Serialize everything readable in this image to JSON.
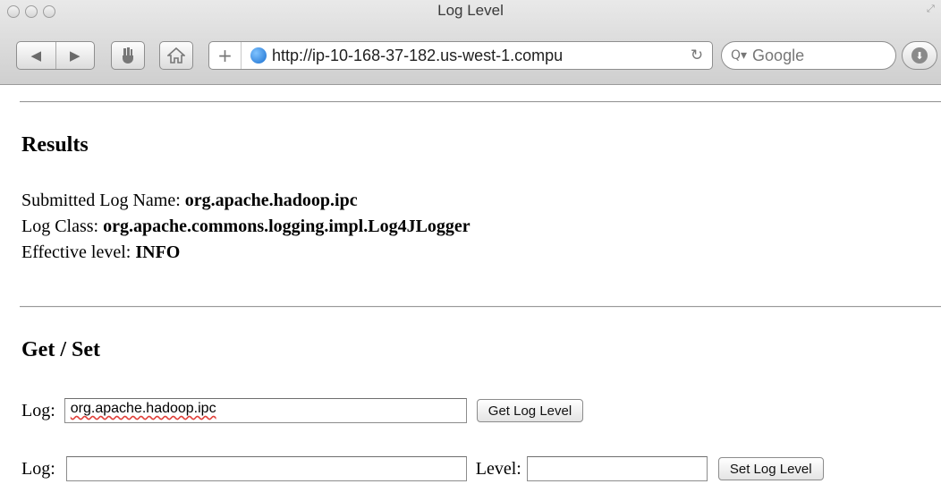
{
  "window": {
    "title": "Log Level"
  },
  "toolbar": {
    "url": "http://ip-10-168-37-182.us-west-1.compu",
    "search_placeholder": "Google"
  },
  "results": {
    "heading": "Results",
    "submitted_label": "Submitted Log Name:",
    "submitted_value": "org.apache.hadoop.ipc",
    "class_label": "Log Class:",
    "class_value": "org.apache.commons.logging.impl.Log4JLogger",
    "effective_label": "Effective level:",
    "effective_value": "INFO"
  },
  "getset": {
    "heading": "Get / Set",
    "get_row": {
      "log_label": "Log:",
      "log_value": "org.apache.hadoop.ipc",
      "button": "Get Log Level"
    },
    "set_row": {
      "log_label": "Log:",
      "log_value": "",
      "level_label": "Level:",
      "level_value": "",
      "button": "Set Log Level"
    }
  },
  "icons": {
    "traffic_lights": [
      "close-icon",
      "minimize-icon",
      "zoom-icon"
    ],
    "toolbar": [
      "back-icon",
      "forward-icon",
      "reader-icon",
      "home-icon",
      "add-tab-icon",
      "globe-icon",
      "reload-icon",
      "search-icon",
      "download-icon",
      "resize-icon"
    ]
  }
}
